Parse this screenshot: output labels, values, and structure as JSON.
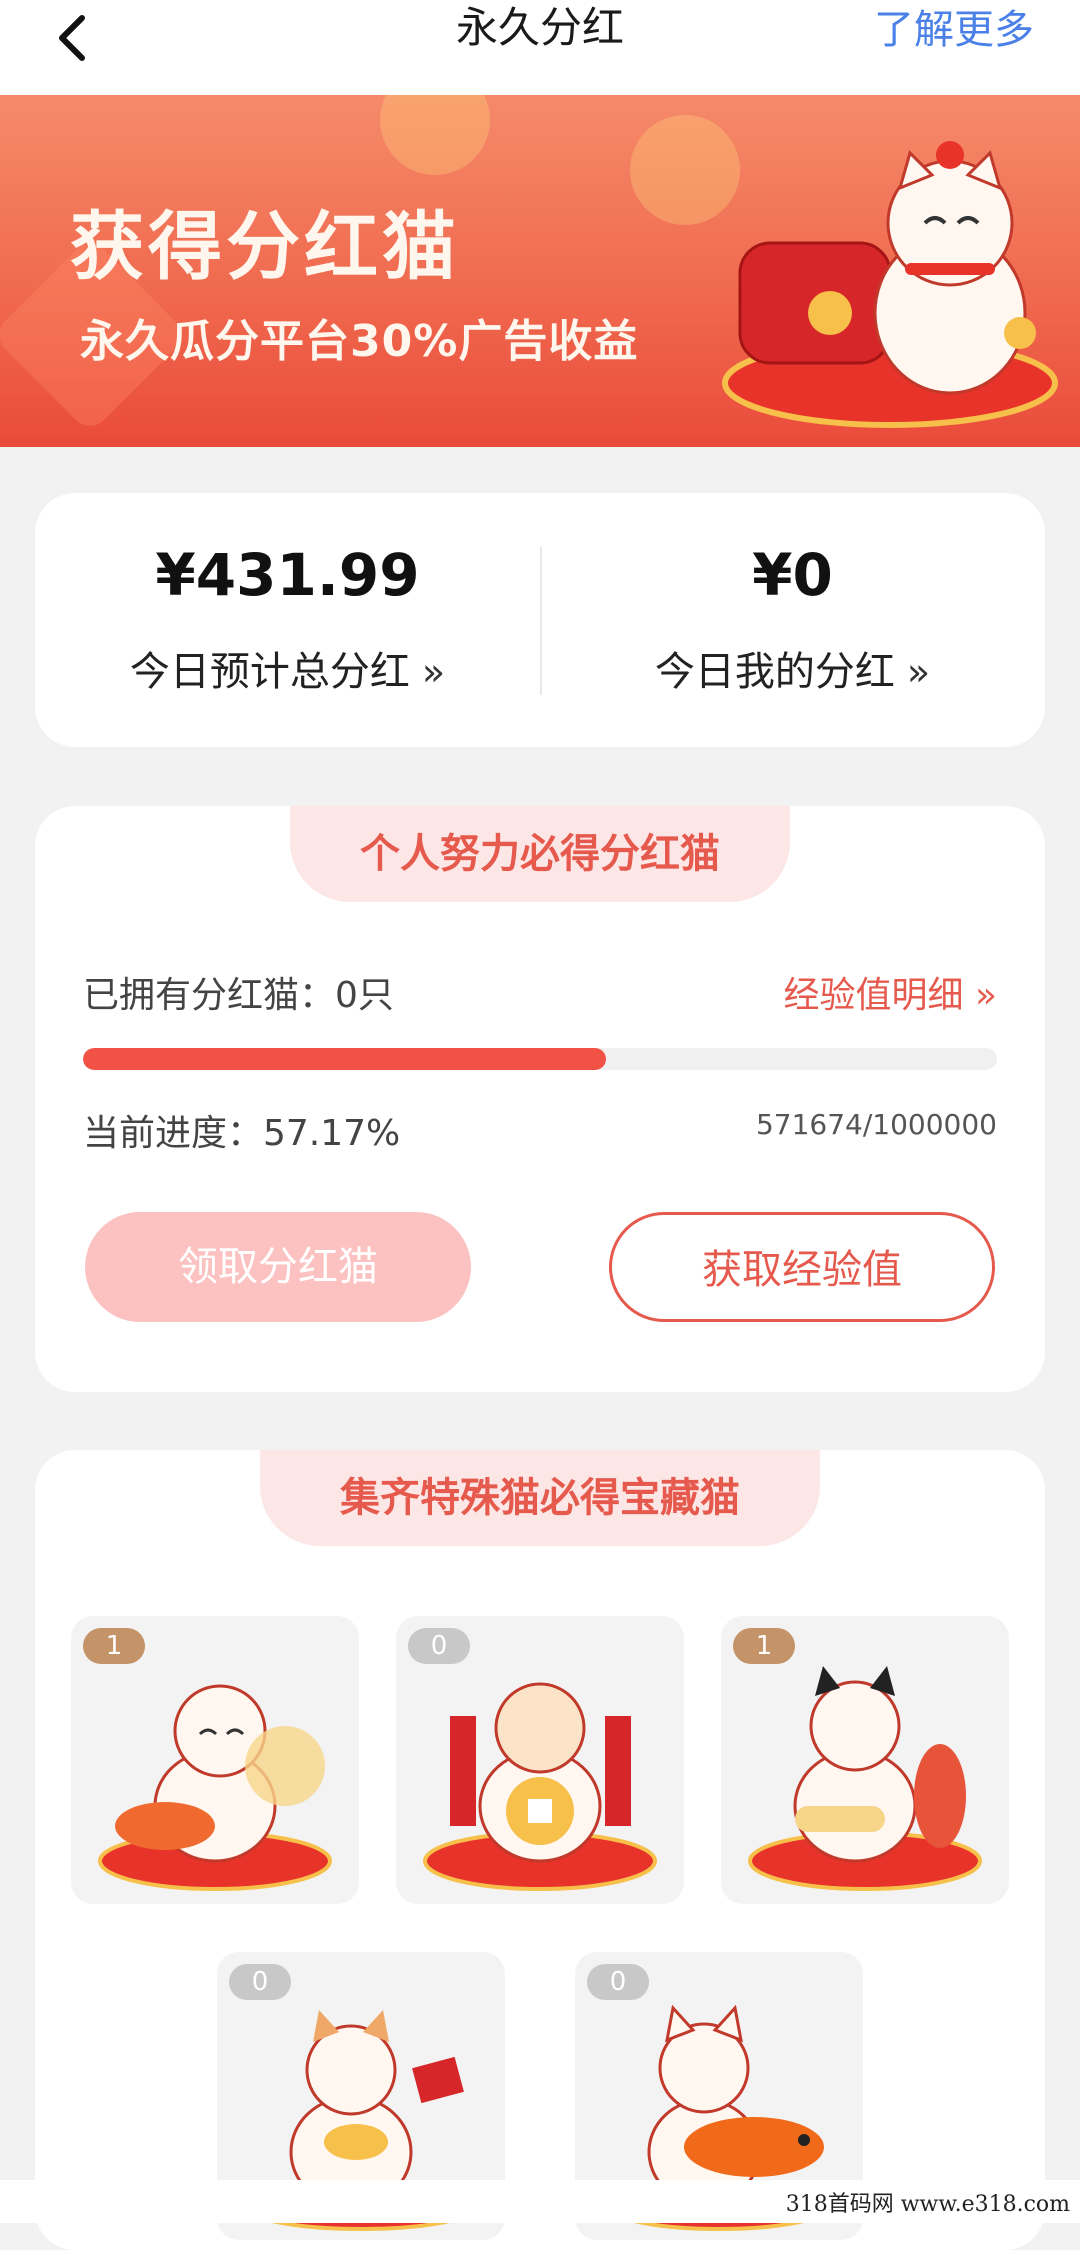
{
  "header": {
    "title": "永久分红",
    "learn_more": "了解更多"
  },
  "banner": {
    "title": "获得分红猫",
    "subtitle": "永久瓜分平台30%广告收益"
  },
  "stats": {
    "total_value": "¥431.99",
    "total_label": "今日预计总分红",
    "mine_value": "¥0",
    "mine_label": "今日我的分红",
    "arrow": "»"
  },
  "effort": {
    "header": "个人努力必得分红猫",
    "owned": "已拥有分红猫：0只",
    "exp_detail": "经验值明细 »",
    "progress_fraction": 0.5717,
    "progress_text": "当前进度：57.17%",
    "ratio": "571674/1000000",
    "claim_button": "领取分红猫",
    "exp_button": "获取经验值"
  },
  "collection": {
    "header": "集齐特殊猫必得宝藏猫",
    "cats": [
      {
        "count": "1",
        "name": "koi-cat"
      },
      {
        "count": "0",
        "name": "fortune-coin-cat"
      },
      {
        "count": "1",
        "name": "black-ear-fish-cat"
      },
      {
        "count": "0",
        "name": "gold-ingot-cat"
      },
      {
        "count": "0",
        "name": "carp-hug-cat"
      }
    ]
  },
  "watermark": "318首码网  www.e318.com",
  "colors": {
    "accent": "#e65a4e",
    "link": "#4a80e8",
    "progress": "#f25246",
    "badge_owned": "#c49468",
    "badge_none": "#c8c8c8"
  }
}
